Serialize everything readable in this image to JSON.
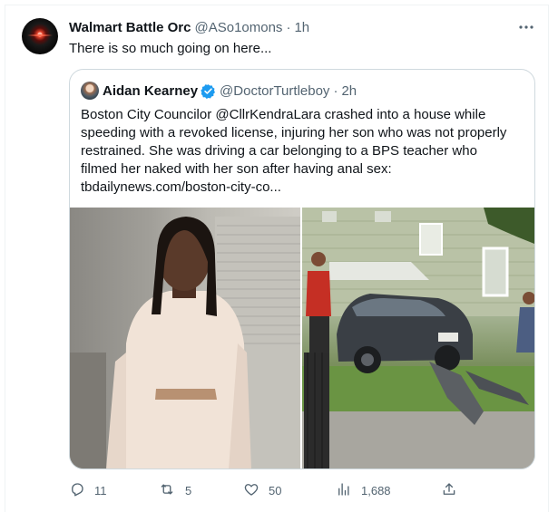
{
  "tweet": {
    "author_name": "Walmart Battle Orc",
    "author_handle": "@ASo1omons",
    "separator": "·",
    "time": "1h",
    "text": "There is so much going on here...",
    "more_icon": "more-horizontal-icon"
  },
  "quote": {
    "author_name": "Aidan Kearney",
    "author_handle": "@DoctorTurtleboy",
    "separator": "·",
    "time": "2h",
    "verified_color": "#1d9bf0",
    "lines": [
      "Boston City Councilor @CllrKendraLara crashed  into a house while",
      "speeding with a revoked license, injuring her son who was not properly",
      "restrained. She was driving a car belonging to a BPS teacher who",
      "filmed her naked with her son after having anal sex:",
      "tbdailynews.com/boston-city-co..."
    ]
  },
  "actions": {
    "replies": "11",
    "retweets": "5",
    "likes": "50",
    "views": "1,688"
  },
  "icons": [
    "reply-icon",
    "retweet-icon",
    "like-icon",
    "views-icon",
    "share-icon"
  ],
  "colors": {
    "muted": "#536471",
    "text": "#0f1419",
    "border": "#cfd9de",
    "accent": "#1d9bf0"
  }
}
